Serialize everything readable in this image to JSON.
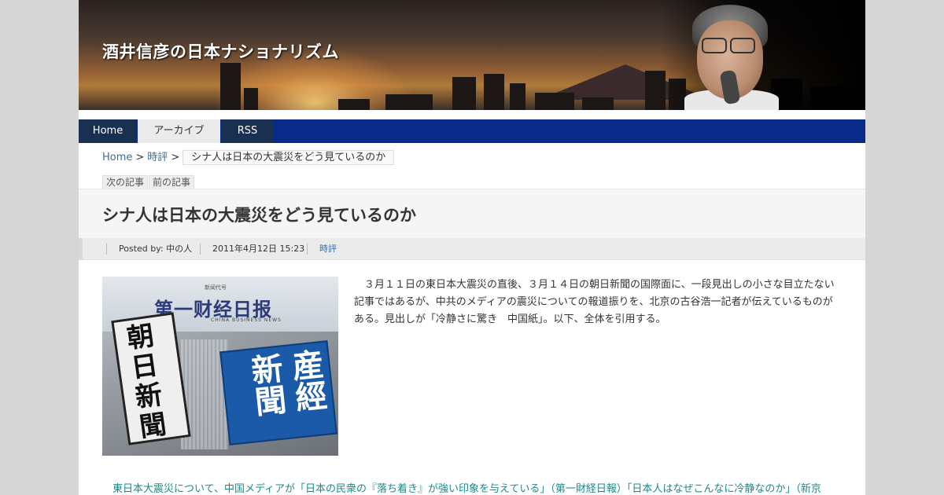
{
  "site": {
    "title": "酒井信彦の日本ナショナリズム"
  },
  "nav": {
    "items": [
      {
        "label": "Home"
      },
      {
        "label": "アーカイブ"
      },
      {
        "label": "RSS"
      }
    ]
  },
  "breadcrumb": {
    "home": "Home",
    "separator": ">",
    "category": "時評",
    "current": "シナ人は日本の大震災をどう見ているのか"
  },
  "post_nav": {
    "next": "次の記事",
    "prev": "前の記事"
  },
  "post": {
    "title": "シナ人は日本の大震災をどう見ているのか",
    "author": "Posted by: 中の人",
    "date": "2011年4月12日 15:23",
    "category": "時評",
    "body": "　３月１１日の東日本大震災の直後、３月１４日の朝日新聞の国際面に、一段見出しの小さな目立たない記事ではあるが、中共のメディアの震災についての報道振りを、北京の古谷浩一記者が伝えているものがある。見出しが「冷静さに驚き　中国紙」。以下、全体を引用する。",
    "quote_link": "東日本大震災について、中国メディアが「日本の民衆の『落ち着き』が強い印象を与えている」（第一財経日報）「日本人はなぜこんなに冷静なのか」（新京"
  },
  "image": {
    "paper_head": "第一财经日报",
    "paper_sub": "新闻代号",
    "paper_en": "CHINA BUSINESS NEWS",
    "asahi": "朝日新聞",
    "sankei": "産經新聞"
  },
  "colors": {
    "nav_bg": "#0a2a8a",
    "nav_active": "#1a3050",
    "link": "#3a6ea5",
    "quote_link": "#1a8a8a"
  }
}
